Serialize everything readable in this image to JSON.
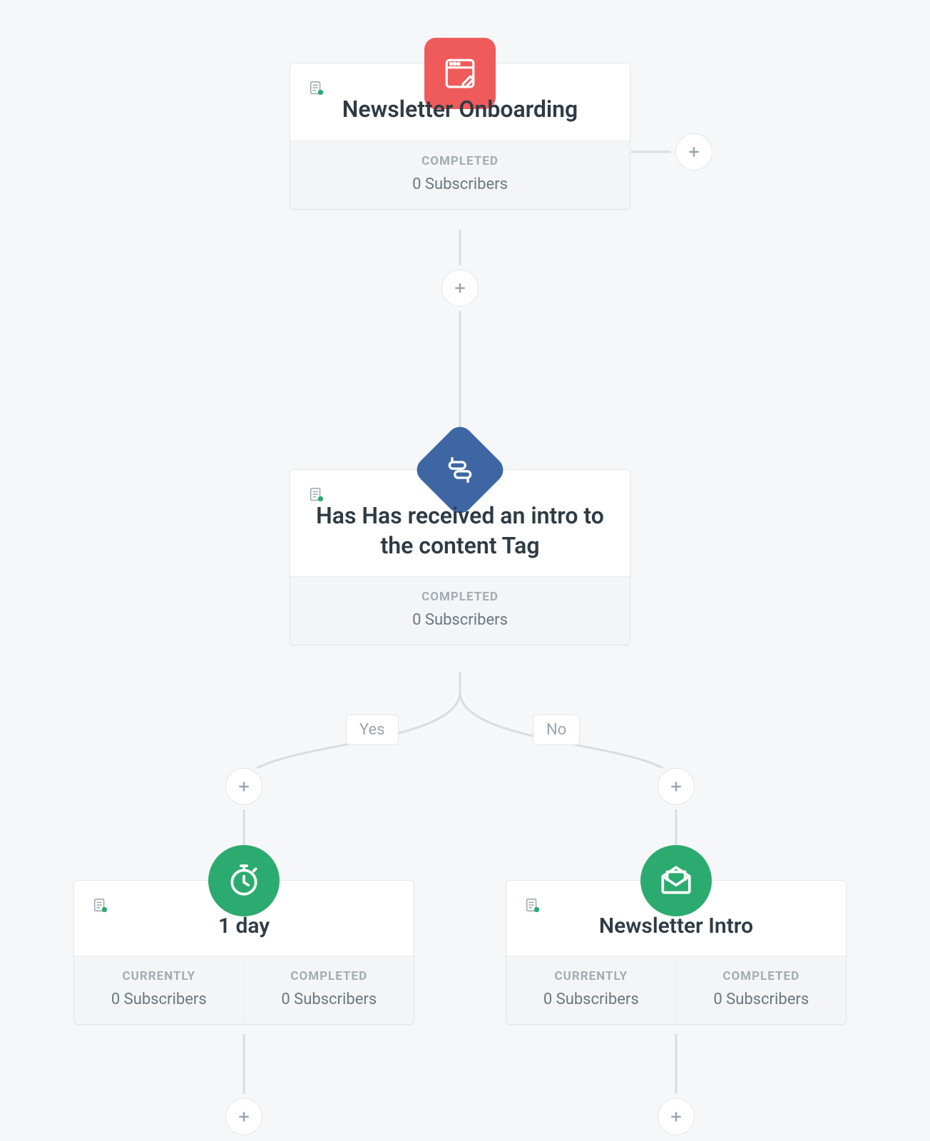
{
  "nodes": {
    "form": {
      "title": "Newsletter Onboarding",
      "stats": [
        {
          "label": "COMPLETED",
          "value": "0 Subscribers"
        }
      ]
    },
    "condition": {
      "title": "Has Has received an intro to the content Tag",
      "stats": [
        {
          "label": "COMPLETED",
          "value": "0 Subscribers"
        }
      ],
      "branches": {
        "yes": "Yes",
        "no": "No"
      }
    },
    "delay": {
      "title": "1 day",
      "stats": [
        {
          "label": "CURRENTLY",
          "value": "0 Subscribers"
        },
        {
          "label": "COMPLETED",
          "value": "0 Subscribers"
        }
      ]
    },
    "email": {
      "title": "Newsletter Intro",
      "stats": [
        {
          "label": "CURRENTLY",
          "value": "0 Subscribers"
        },
        {
          "label": "COMPLETED",
          "value": "0 Subscribers"
        }
      ]
    }
  }
}
